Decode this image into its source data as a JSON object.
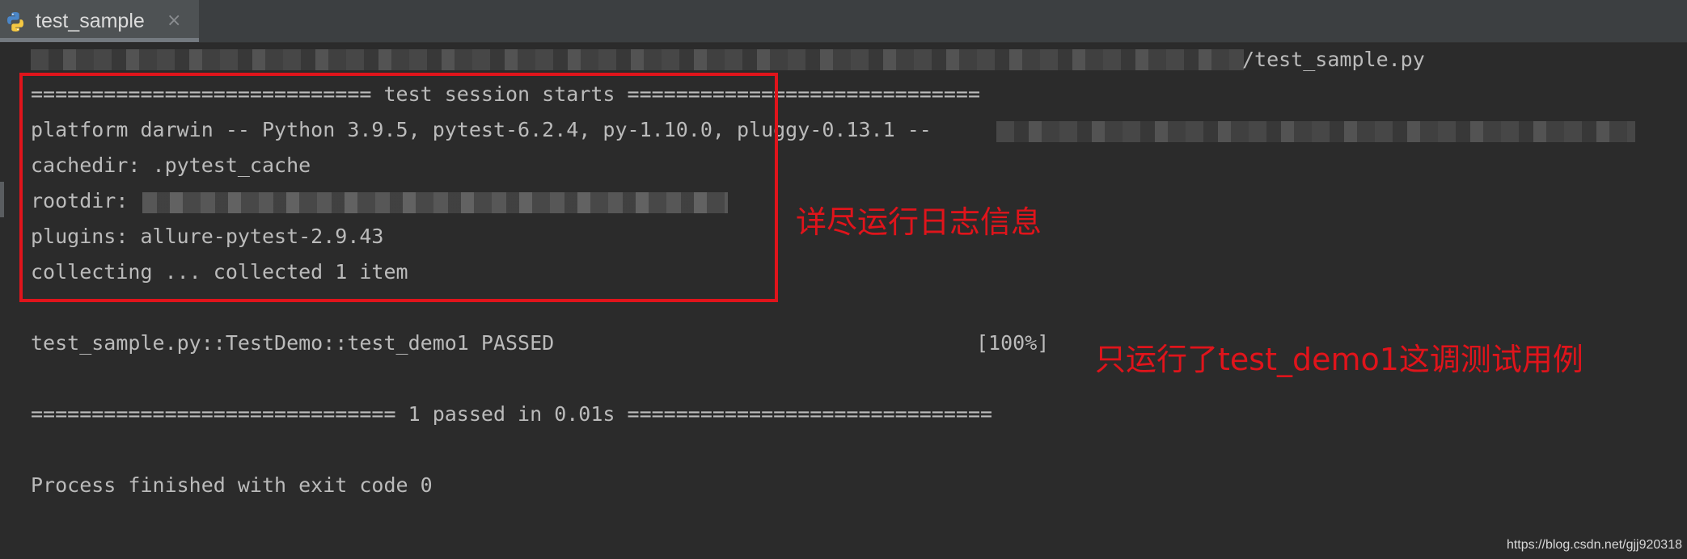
{
  "tab": {
    "icon": "python-icon",
    "title": "test_sample",
    "close_glyph": "×"
  },
  "console": {
    "path_line": "/test_sample.py",
    "lines": [
      "============================ test session starts =============================",
      "platform darwin -- Python 3.9.5, pytest-6.2.4, py-1.10.0, pluggy-0.13.1 --",
      "cachedir: .pytest_cache",
      "rootdir:",
      "plugins: allure-pytest-2.9.43",
      "collecting ... collected 1 item"
    ],
    "result_test": "test_sample.py::TestDemo::test_demo1 PASSED",
    "result_percent": "[100%]",
    "summary": "============================== 1 passed in 0.01s ==============================",
    "exit_message": "Process finished with exit code 0"
  },
  "annotations": {
    "verbose_log": "详尽运行日志信息",
    "only_ran": "只运行了test_demo1这调测试用例"
  },
  "watermark": "https://blog.csdn.net/gjj920318",
  "colors": {
    "background": "#2b2b2b",
    "text": "#bbbbbb",
    "annotation_red": "#e0141b"
  }
}
